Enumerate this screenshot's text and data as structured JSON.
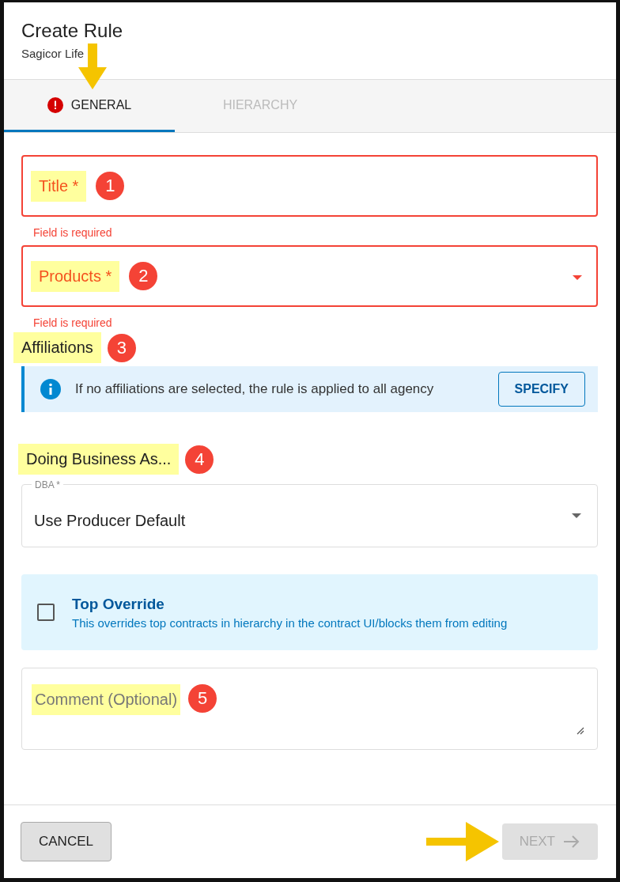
{
  "dialog": {
    "title": "Create Rule",
    "subtitle": "Sagicor Life"
  },
  "tabs": [
    {
      "label": "GENERAL",
      "selected": true,
      "error": true
    },
    {
      "label": "HIERARCHY",
      "selected": false,
      "error": false
    }
  ],
  "fields": [
    {
      "label": "Title *",
      "error": "Field is required",
      "invalid": true,
      "dropdown": false,
      "marker": "1"
    },
    {
      "label": "Products *",
      "error": "Field is required",
      "invalid": true,
      "dropdown": true,
      "marker": "2"
    }
  ],
  "affiliations": {
    "heading": "Affiliations",
    "marker": "3",
    "info": "If no affiliations are selected, the rule is applied to all agency",
    "button": "SPECIFY"
  },
  "dba": {
    "heading": "Doing Business As...",
    "marker": "4",
    "label": "DBA *",
    "value": "Use Producer Default"
  },
  "override": {
    "title": "Top Override",
    "description": "This overrides top contracts in hierarchy in the contract UI/blocks them from editing",
    "checked": false
  },
  "comment": {
    "placeholder": "Comment (Optional)",
    "marker": "5"
  },
  "footer": {
    "cancel": "CANCEL",
    "next": "NEXT",
    "next_disabled": true
  }
}
